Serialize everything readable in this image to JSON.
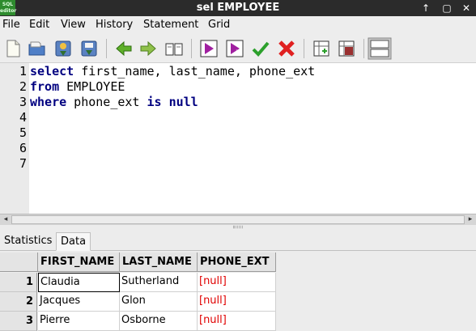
{
  "window": {
    "app_icon_text": "SQL\neditor",
    "title": "sel EMPLOYEE",
    "btn_up": "↑",
    "btn_box": "▢",
    "btn_close": "✕"
  },
  "menu": [
    "File",
    "Edit",
    "View",
    "History",
    "Statement",
    "Grid"
  ],
  "toolbar": {
    "icons": [
      "new-file-icon",
      "open-folder-icon",
      "save-icon",
      "save-as-icon",
      "back-arrow-icon",
      "forward-arrow-icon",
      "book-icon",
      "execute-icon",
      "execute-step-icon",
      "commit-check-icon",
      "rollback-x-icon",
      "grid-add-icon",
      "grid-remove-icon",
      "layout-toggle-icon"
    ]
  },
  "editor": {
    "line_numbers": [
      "1",
      "2",
      "3",
      "4",
      "5",
      "6",
      "7"
    ],
    "lines": [
      {
        "kw": "select",
        "rest": " first_name, last_name, phone_ext"
      },
      {
        "kw": "from",
        "rest": " EMPLOYEE"
      },
      {
        "kw": "where",
        "rest": " phone_ext ",
        "kw2": "is null"
      }
    ]
  },
  "tabs": {
    "statistics": "Statistics",
    "data": "Data"
  },
  "grid": {
    "columns": [
      "FIRST_NAME",
      "LAST_NAME",
      "PHONE_EXT"
    ],
    "rows": [
      {
        "num": "1",
        "first_name": "Claudia",
        "last_name": "Sutherland",
        "phone_ext": "[null]"
      },
      {
        "num": "2",
        "first_name": "Jacques",
        "last_name": "Glon",
        "phone_ext": "[null]"
      },
      {
        "num": "3",
        "first_name": "Pierre",
        "last_name": "Osborne",
        "phone_ext": "[null]"
      }
    ]
  },
  "colors": {
    "keyword": "#000080",
    "null_value": "#e00000",
    "titlebar": "#2b2b2b"
  }
}
